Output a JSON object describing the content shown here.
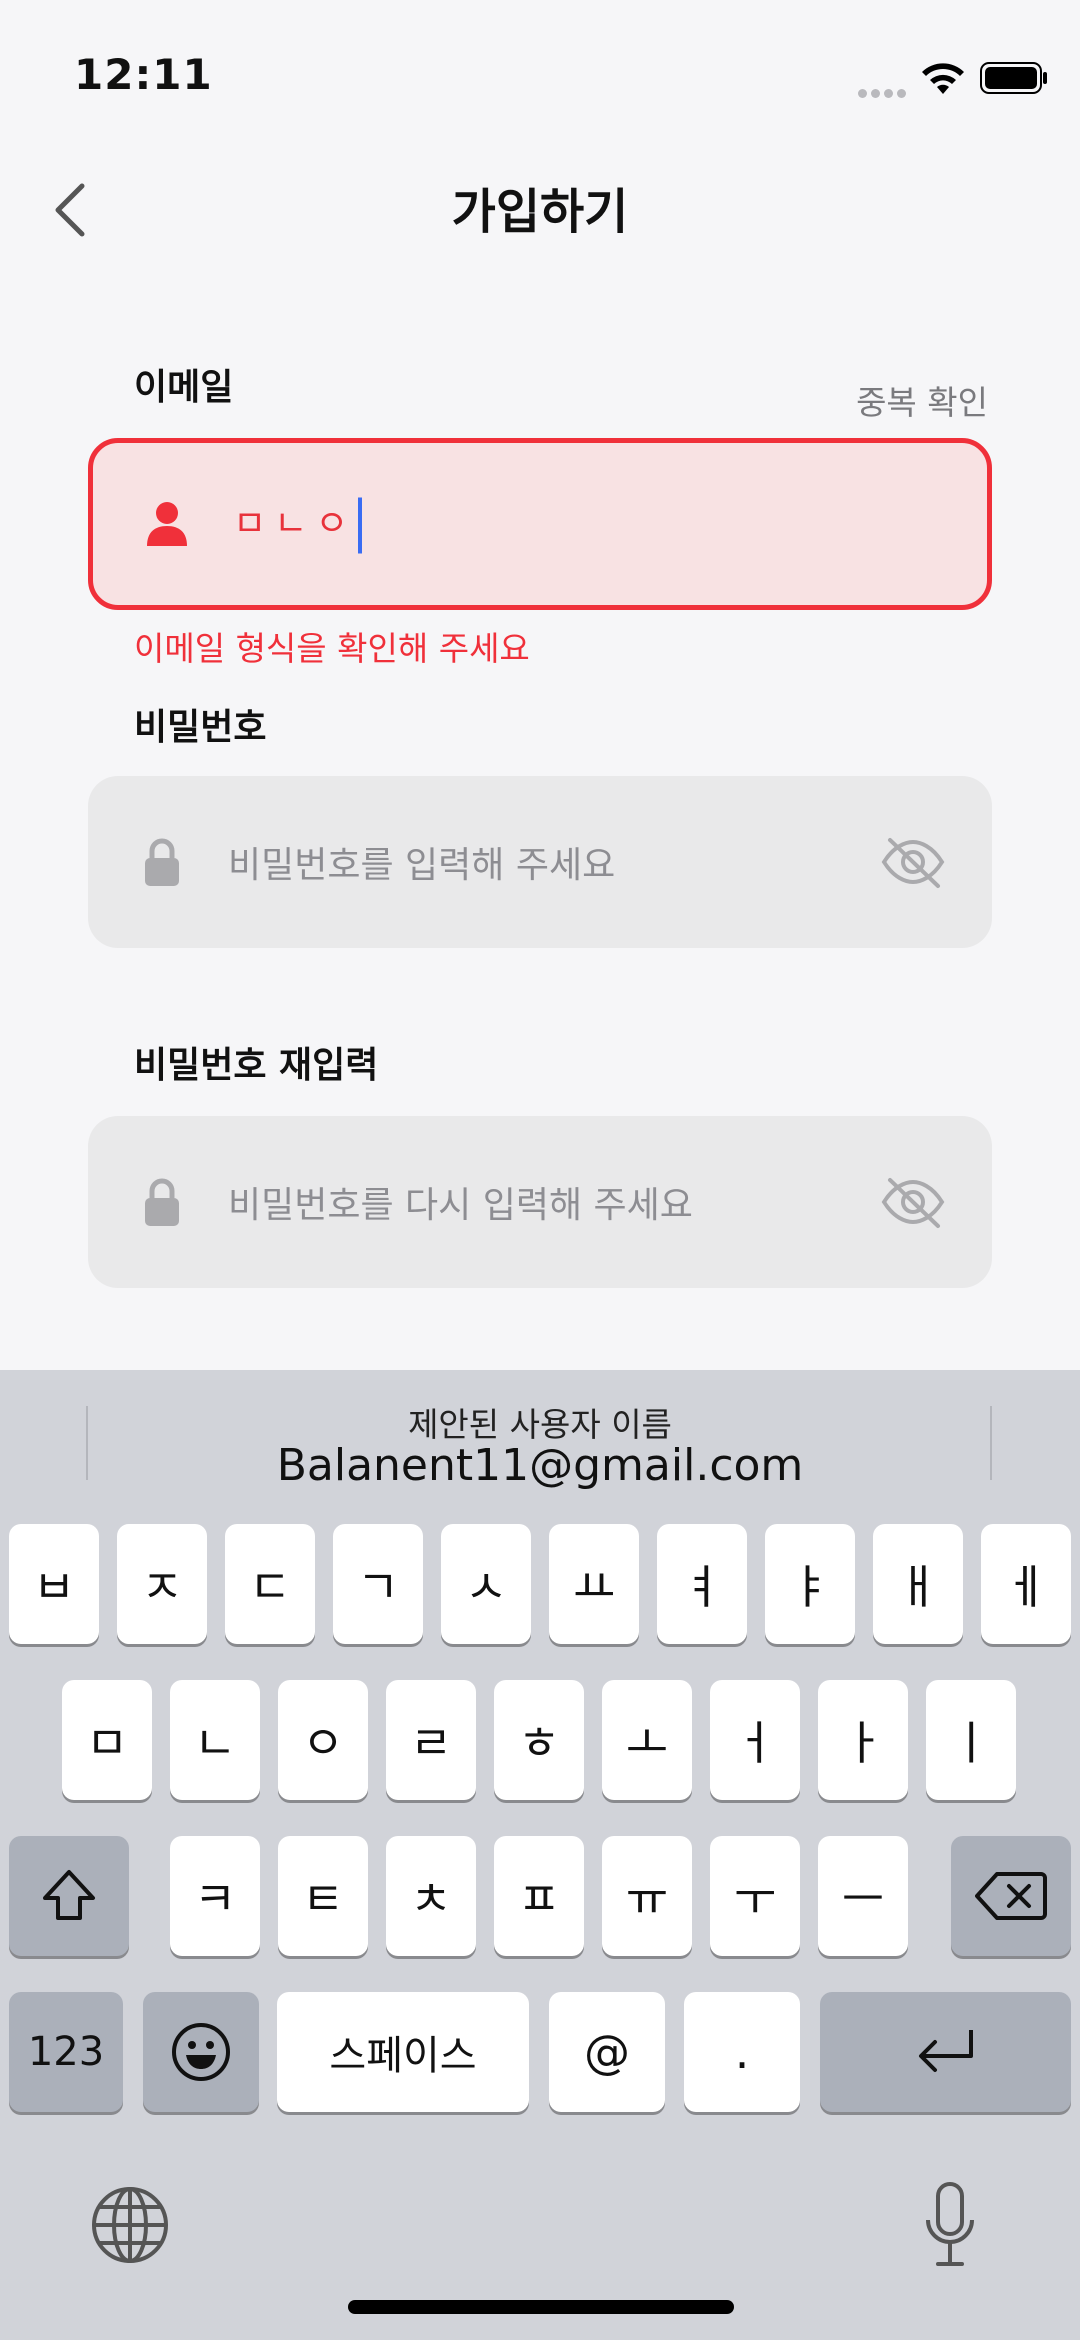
{
  "status_bar": {
    "time": "12:11"
  },
  "header": {
    "title": "가입하기",
    "back_icon": "chevron-left-icon"
  },
  "email": {
    "label": "이메일",
    "dup_check_label": "중복 확인",
    "value": "ㅁㄴㅇ",
    "icon": "person-icon",
    "error": "이메일 형식을 확인해 주세요",
    "error_color": "#f0303a"
  },
  "password": {
    "label": "비밀번호",
    "placeholder": "비밀번호를 입력해 주세요",
    "icon": "lock-icon",
    "toggle_icon": "eye-slash-icon"
  },
  "password_confirm": {
    "label": "비밀번호 재입력",
    "placeholder": "비밀번호를 다시 입력해 주세요",
    "icon": "lock-icon",
    "toggle_icon": "eye-slash-icon"
  },
  "keyboard": {
    "suggestion_title": "제안된 사용자 이름",
    "suggestion_value": "Balanent11@gmail.com",
    "row1": [
      "ㅂ",
      "ㅈ",
      "ㄷ",
      "ㄱ",
      "ㅅ",
      "ㅛ",
      "ㅕ",
      "ㅑ",
      "ㅐ",
      "ㅔ"
    ],
    "row2": [
      "ㅁ",
      "ㄴ",
      "ㅇ",
      "ㄹ",
      "ㅎ",
      "ㅗ",
      "ㅓ",
      "ㅏ",
      "ㅣ"
    ],
    "row3": [
      "ㅋ",
      "ㅌ",
      "ㅊ",
      "ㅍ",
      "ㅠ",
      "ㅜ",
      "ㅡ"
    ],
    "numbers_label": "123",
    "space_label": "스페이스",
    "at_label": "@",
    "dot_label": "."
  }
}
